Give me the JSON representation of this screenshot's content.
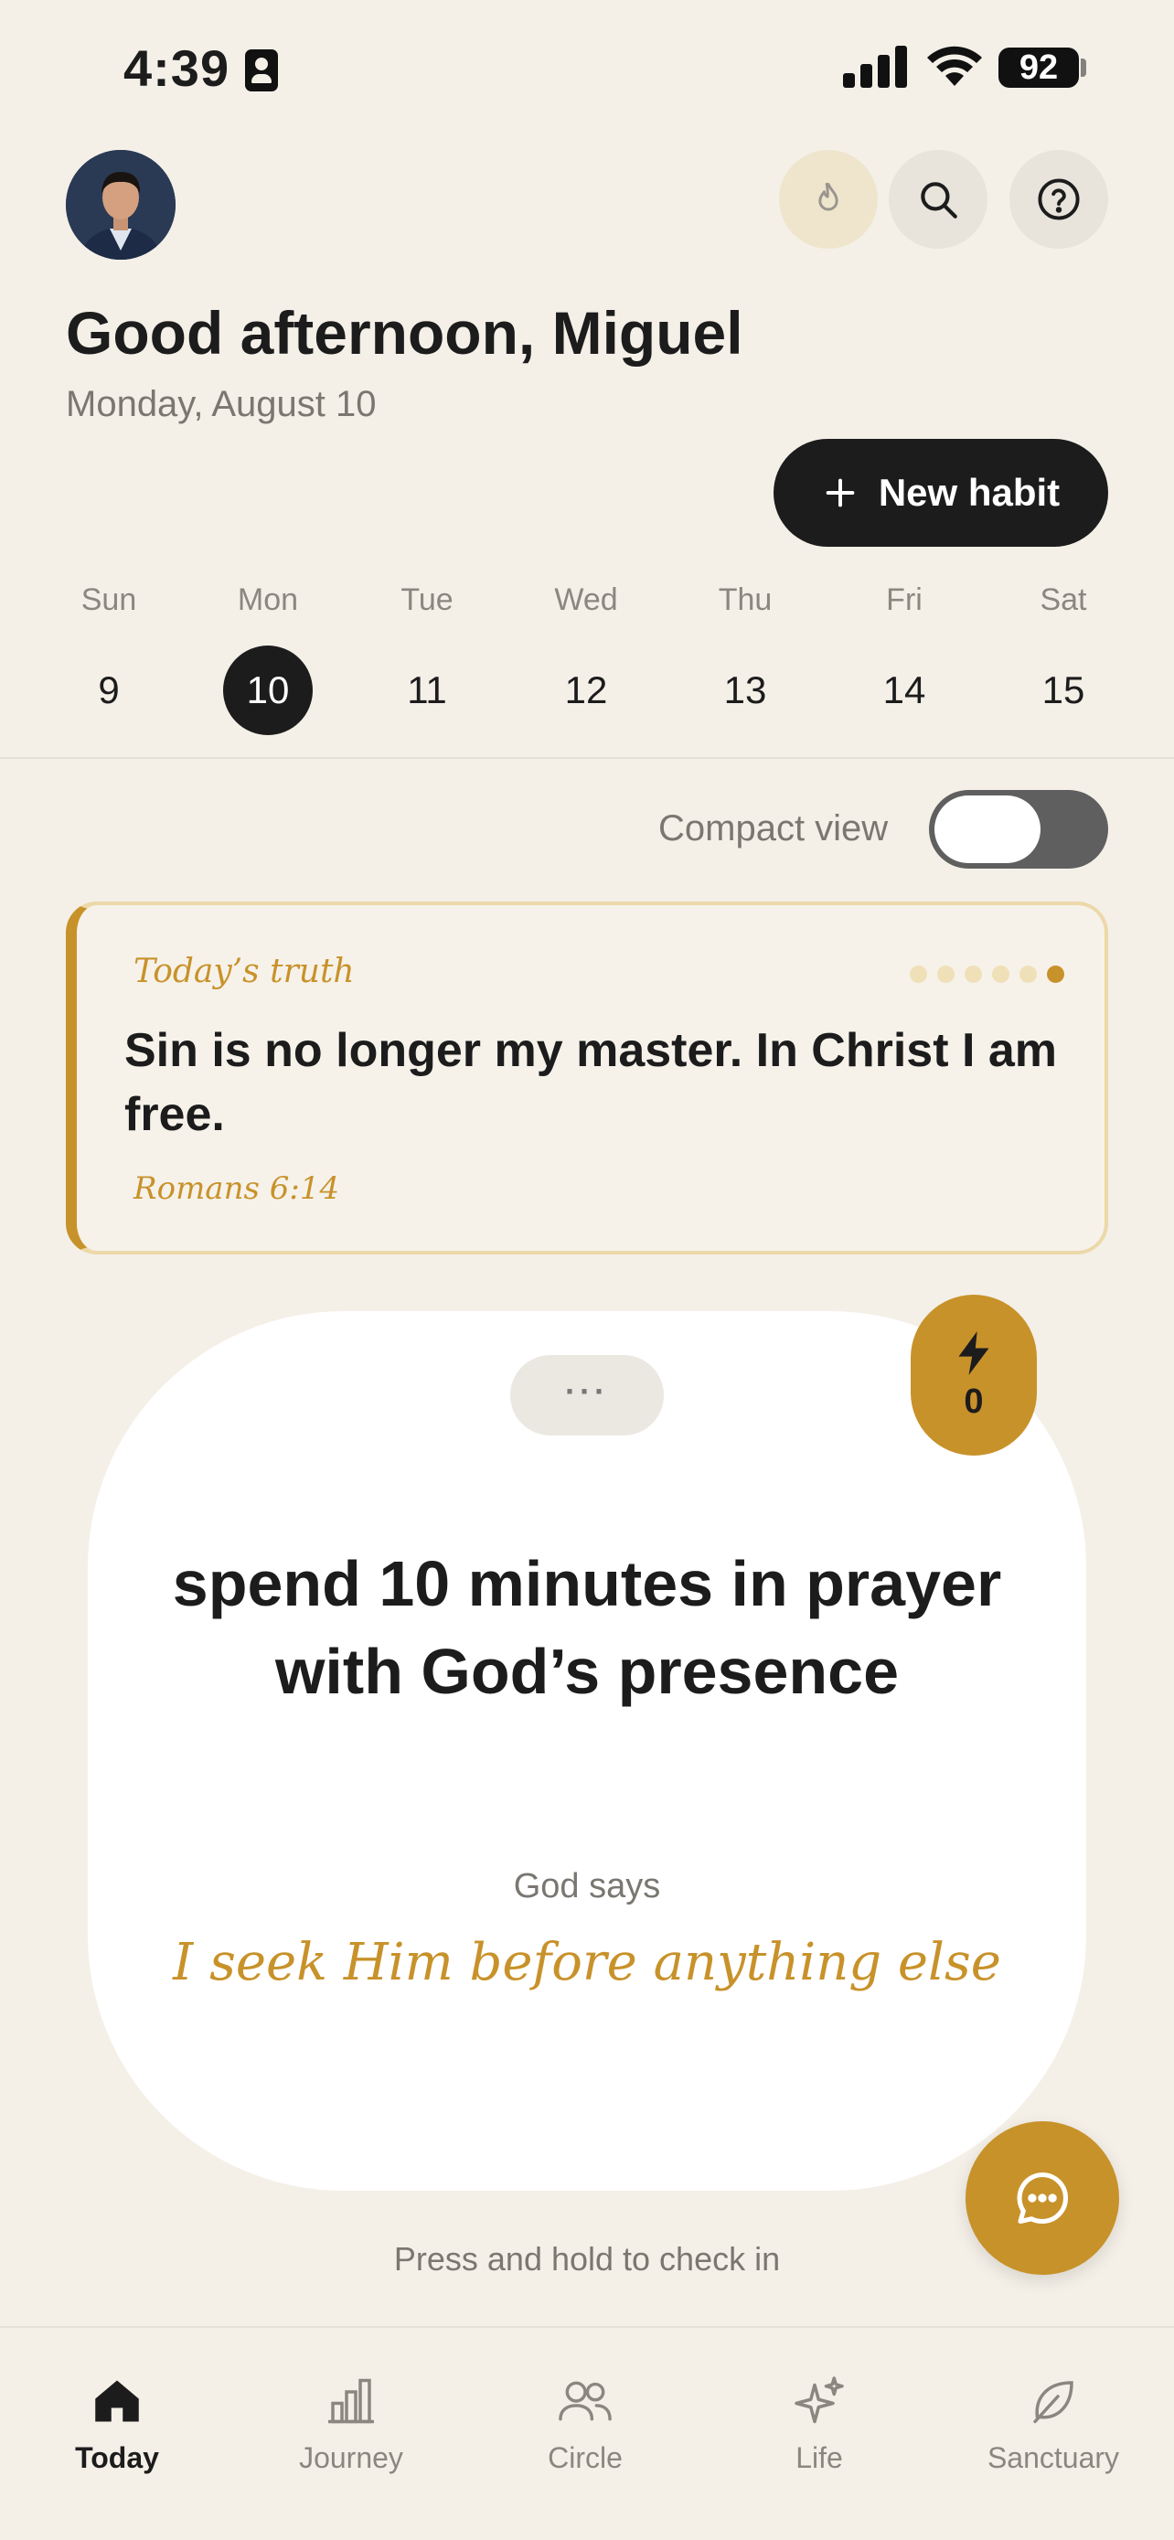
{
  "status_bar": {
    "time": "4:39",
    "battery": "92"
  },
  "header": {
    "greeting": "Good afternoon, Miguel",
    "date": "Monday, August 10",
    "new_habit_label": "New habit"
  },
  "week": [
    {
      "name": "Sun",
      "date": "9",
      "selected": false
    },
    {
      "name": "Mon",
      "date": "10",
      "selected": true
    },
    {
      "name": "Tue",
      "date": "11",
      "selected": false
    },
    {
      "name": "Wed",
      "date": "12",
      "selected": false
    },
    {
      "name": "Thu",
      "date": "13",
      "selected": false
    },
    {
      "name": "Fri",
      "date": "14",
      "selected": false
    },
    {
      "name": "Sat",
      "date": "15",
      "selected": false
    }
  ],
  "compact_view": {
    "label": "Compact view",
    "on": false
  },
  "truth": {
    "title": "Today’s truth",
    "text": "Sin is no longer my master. In Christ I am free.",
    "reference": "Romans 6:14",
    "pager": {
      "count": 6,
      "active": 6
    }
  },
  "habit": {
    "more_label": "···",
    "title": "spend 10 minutes in prayer with God’s presence",
    "god_says_label": "God says",
    "affirmation": "I seek Him before anything else",
    "streak": "0"
  },
  "press_hint": "Press and hold to check in",
  "tabs": [
    {
      "label": "Today",
      "icon": "home-icon",
      "active": true
    },
    {
      "label": "Journey",
      "icon": "bar-chart-icon",
      "active": false
    },
    {
      "label": "Circle",
      "icon": "people-icon",
      "active": false
    },
    {
      "label": "Life",
      "icon": "sparkles-icon",
      "active": false
    },
    {
      "label": "Sanctuary",
      "icon": "leaf-icon",
      "active": false
    }
  ],
  "colors": {
    "accent": "#c8922a",
    "background": "#f4f0e8",
    "dark": "#1c1c1c"
  }
}
